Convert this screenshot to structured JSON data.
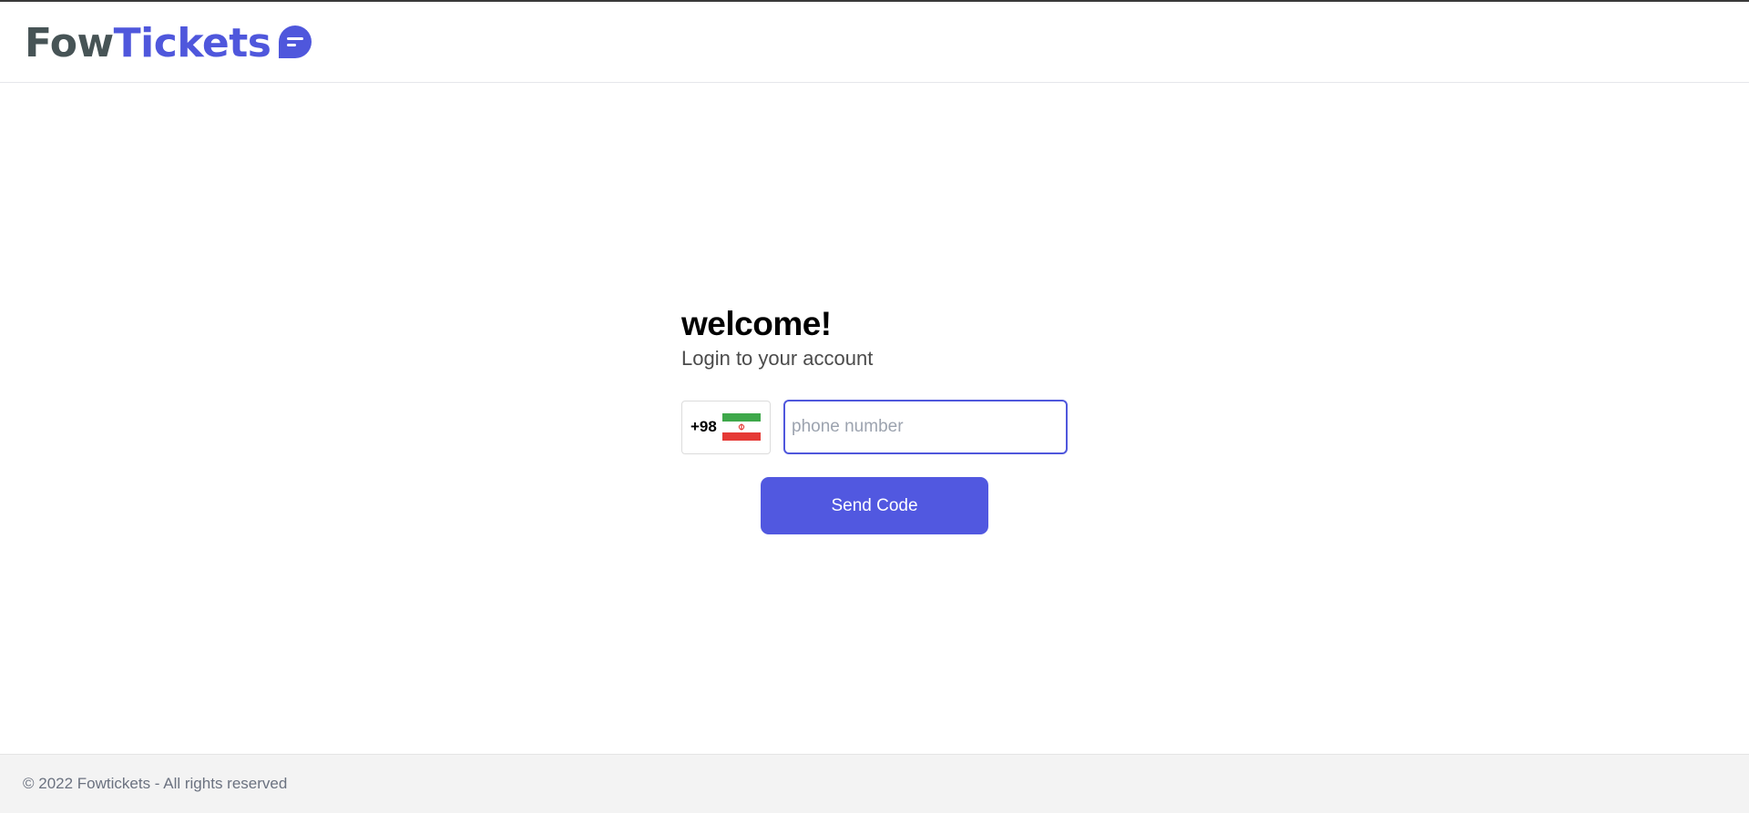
{
  "header": {
    "logo": {
      "part1": "Fow",
      "part2": "Tickets",
      "part1_color": "#475456",
      "part2_color": "#4f57dc",
      "icon": "chat-bubble-icon"
    }
  },
  "login": {
    "title": "welcome!",
    "subtitle": "Login to your account",
    "country_code": "+98",
    "country_flag_icon": "iran-flag-icon",
    "phone_placeholder": "phone number",
    "phone_value": "",
    "submit_label": "Send Code",
    "accent_color": "#5158e0"
  },
  "footer": {
    "text": "© 2022 Fowtickets - All rights reserved"
  }
}
